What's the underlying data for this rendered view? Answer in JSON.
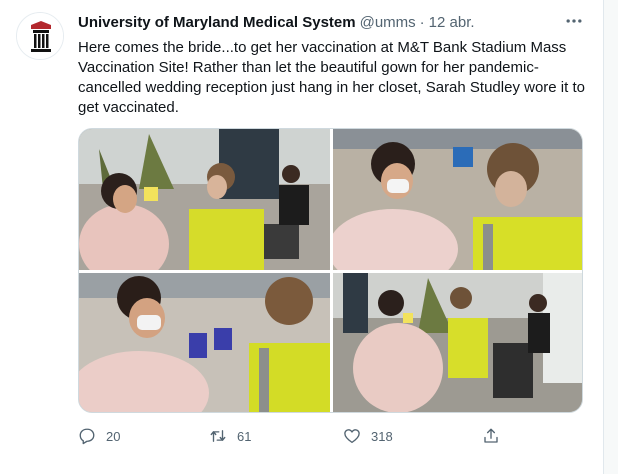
{
  "tweet": {
    "display_name": "University of Maryland Medical System",
    "handle": "@umms",
    "separator": "·",
    "time": "12 abr.",
    "text": "Here comes the bride...to get her vaccination at M&T Bank Stadium Mass Vaccination Site! Rather than let the beautiful gown for her pandemic-cancelled wedding reception just hang in her closet, Sarah Studley wore it to get vaccinated."
  },
  "actions": {
    "replies": "20",
    "retweets": "61",
    "likes": "318"
  },
  "icons": {
    "avatar": "umms-logo",
    "more": "more-horizontal-icon",
    "reply": "reply-icon",
    "retweet": "retweet-icon",
    "like": "heart-icon",
    "share": "share-icon"
  },
  "colors": {
    "text_primary": "#0f1419",
    "text_secondary": "#536471",
    "border": "#cfd9de"
  }
}
